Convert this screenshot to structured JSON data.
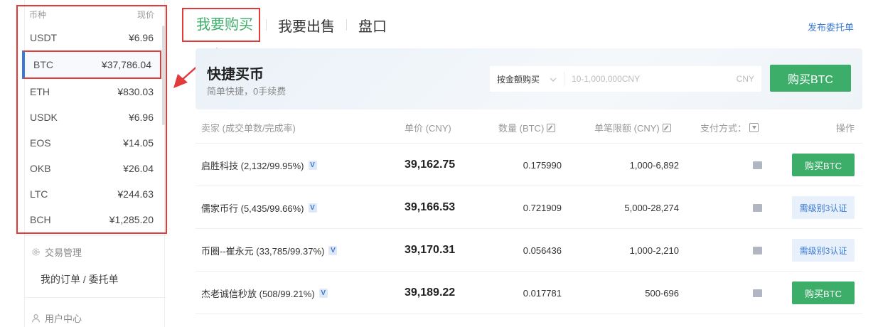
{
  "sidebar": {
    "coin_header": {
      "coin": "币种",
      "price": "现价"
    },
    "coins": [
      {
        "symbol": "USDT",
        "price": "¥6.96"
      },
      {
        "symbol": "BTC",
        "price": "¥37,786.04"
      },
      {
        "symbol": "ETH",
        "price": "¥830.03"
      },
      {
        "symbol": "USDK",
        "price": "¥6.96"
      },
      {
        "symbol": "EOS",
        "price": "¥14.05"
      },
      {
        "symbol": "OKB",
        "price": "¥26.04"
      },
      {
        "symbol": "LTC",
        "price": "¥244.63"
      },
      {
        "symbol": "BCH",
        "price": "¥1,285.20"
      }
    ],
    "trade_section": {
      "title": "交易管理",
      "item": "我的订单 / 委托单"
    },
    "user_section": {
      "title": "用户中心"
    }
  },
  "tabs": [
    {
      "label": "我要购买"
    },
    {
      "label": "我要出售"
    },
    {
      "label": "盘口"
    }
  ],
  "post_link": "发布委托单",
  "quick": {
    "title": "快捷买币",
    "subtitle": "简单快捷，0手续费",
    "mode": "按金额购买",
    "placeholder": "10-1,000,000CNY",
    "unit": "CNY",
    "button": "购买BTC"
  },
  "table": {
    "headers": {
      "seller": "卖家 (成交单数/完成率)",
      "price": "单价 (CNY)",
      "qty": "数量 (BTC)",
      "limit": "单笔限额 (CNY)",
      "pay": "支付方式：",
      "action": "操作"
    },
    "rows": [
      {
        "seller": "启胜科技 (2,132/99.95%)",
        "price": "39,162.75",
        "qty": "0.175990",
        "limit": "1,000-6,892",
        "action": "购买BTC",
        "action_type": "buy"
      },
      {
        "seller": "儒家币行 (5,435/99.66%)",
        "price": "39,166.53",
        "qty": "0.721909",
        "limit": "5,000-28,274",
        "action": "需级别3认证",
        "action_type": "kyc"
      },
      {
        "seller": "币圈--崔永元 (33,785/99.37%)",
        "price": "39,170.31",
        "qty": "0.056436",
        "limit": "1,000-2,210",
        "action": "需级别3认证",
        "action_type": "kyc"
      },
      {
        "seller": "杰老诚信秒放 (508/99.21%)",
        "price": "39,189.22",
        "qty": "0.017781",
        "limit": "500-696",
        "action": "购买BTC",
        "action_type": "buy"
      }
    ]
  },
  "colors": {
    "accent_green": "#3dae6a",
    "link_blue": "#3b7bd4",
    "highlight_red": "#e23b3b"
  }
}
